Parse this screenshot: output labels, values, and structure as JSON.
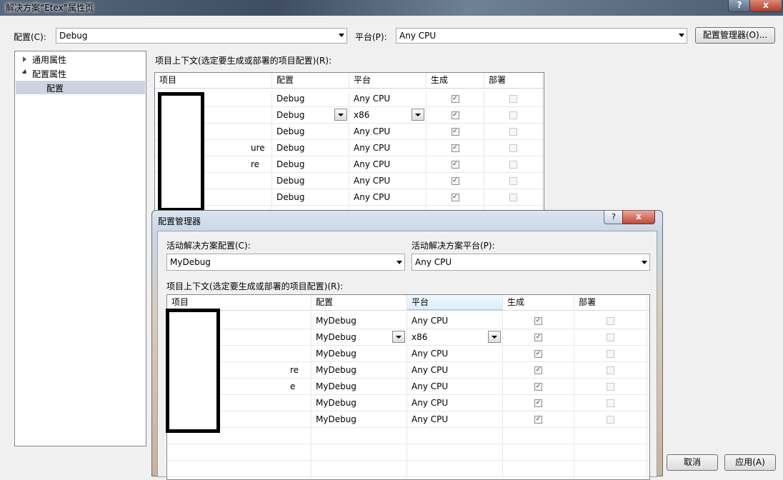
{
  "window": {
    "title": "解决方案“Etex”属性页",
    "help_glyph": "?",
    "close_glyph": "x"
  },
  "top": {
    "config_label": "配置(C):",
    "config_value": "Debug",
    "platform_label": "平台(P):",
    "platform_value": "Any CPU",
    "config_manager_button": "配置管理器(O)..."
  },
  "tree": {
    "items": [
      {
        "label": "通用属性"
      },
      {
        "label": "配置属性"
      },
      {
        "label": "配置"
      }
    ]
  },
  "main_grid": {
    "caption": "项目上下文(选定要生成或部署的项目配置)(R):",
    "headers": [
      "项目",
      "配置",
      "平台",
      "生成",
      "部署"
    ],
    "rows": [
      {
        "project": "",
        "config": "Debug",
        "platform": "Any CPU",
        "build": true,
        "deploy": false
      },
      {
        "project": "",
        "config": "Debug",
        "platform": "x86",
        "build": true,
        "deploy": false
      },
      {
        "project": "",
        "config": "Debug",
        "platform": "Any CPU",
        "build": true,
        "deploy": false
      },
      {
        "project": "ure",
        "config": "Debug",
        "platform": "Any CPU",
        "build": true,
        "deploy": false
      },
      {
        "project": "re",
        "config": "Debug",
        "platform": "Any CPU",
        "build": true,
        "deploy": false
      },
      {
        "project": "",
        "config": "Debug",
        "platform": "Any CPU",
        "build": true,
        "deploy": false
      },
      {
        "project": "",
        "config": "Debug",
        "platform": "Any CPU",
        "build": true,
        "deploy": false
      }
    ]
  },
  "config_manager": {
    "title": "配置管理器",
    "help_glyph": "?",
    "close_glyph": "x",
    "active_config_label": "活动解决方案配置(C):",
    "active_config_value": "MyDebug",
    "active_platform_label": "活动解决方案平台(P):",
    "active_platform_value": "Any CPU",
    "caption": "项目上下文(选定要生成或部署的项目配置)(R):",
    "headers": [
      "项目",
      "配置",
      "平台",
      "生成",
      "部署"
    ],
    "rows": [
      {
        "project": "",
        "config": "MyDebug",
        "platform": "Any CPU",
        "build": true,
        "deploy": false
      },
      {
        "project": "",
        "config": "MyDebug",
        "platform": "x86",
        "build": true,
        "deploy": false
      },
      {
        "project": "",
        "config": "MyDebug",
        "platform": "Any CPU",
        "build": true,
        "deploy": false
      },
      {
        "project": "re",
        "config": "MyDebug",
        "platform": "Any CPU",
        "build": true,
        "deploy": false
      },
      {
        "project": "e",
        "config": "MyDebug",
        "platform": "Any CPU",
        "build": true,
        "deploy": false
      },
      {
        "project": "",
        "config": "MyDebug",
        "platform": "Any CPU",
        "build": true,
        "deploy": false
      },
      {
        "project": "",
        "config": "MyDebug",
        "platform": "Any CPU",
        "build": true,
        "deploy": false
      }
    ]
  },
  "bottom": {
    "cancel_label": "取消",
    "apply_label": "应用(A)"
  }
}
